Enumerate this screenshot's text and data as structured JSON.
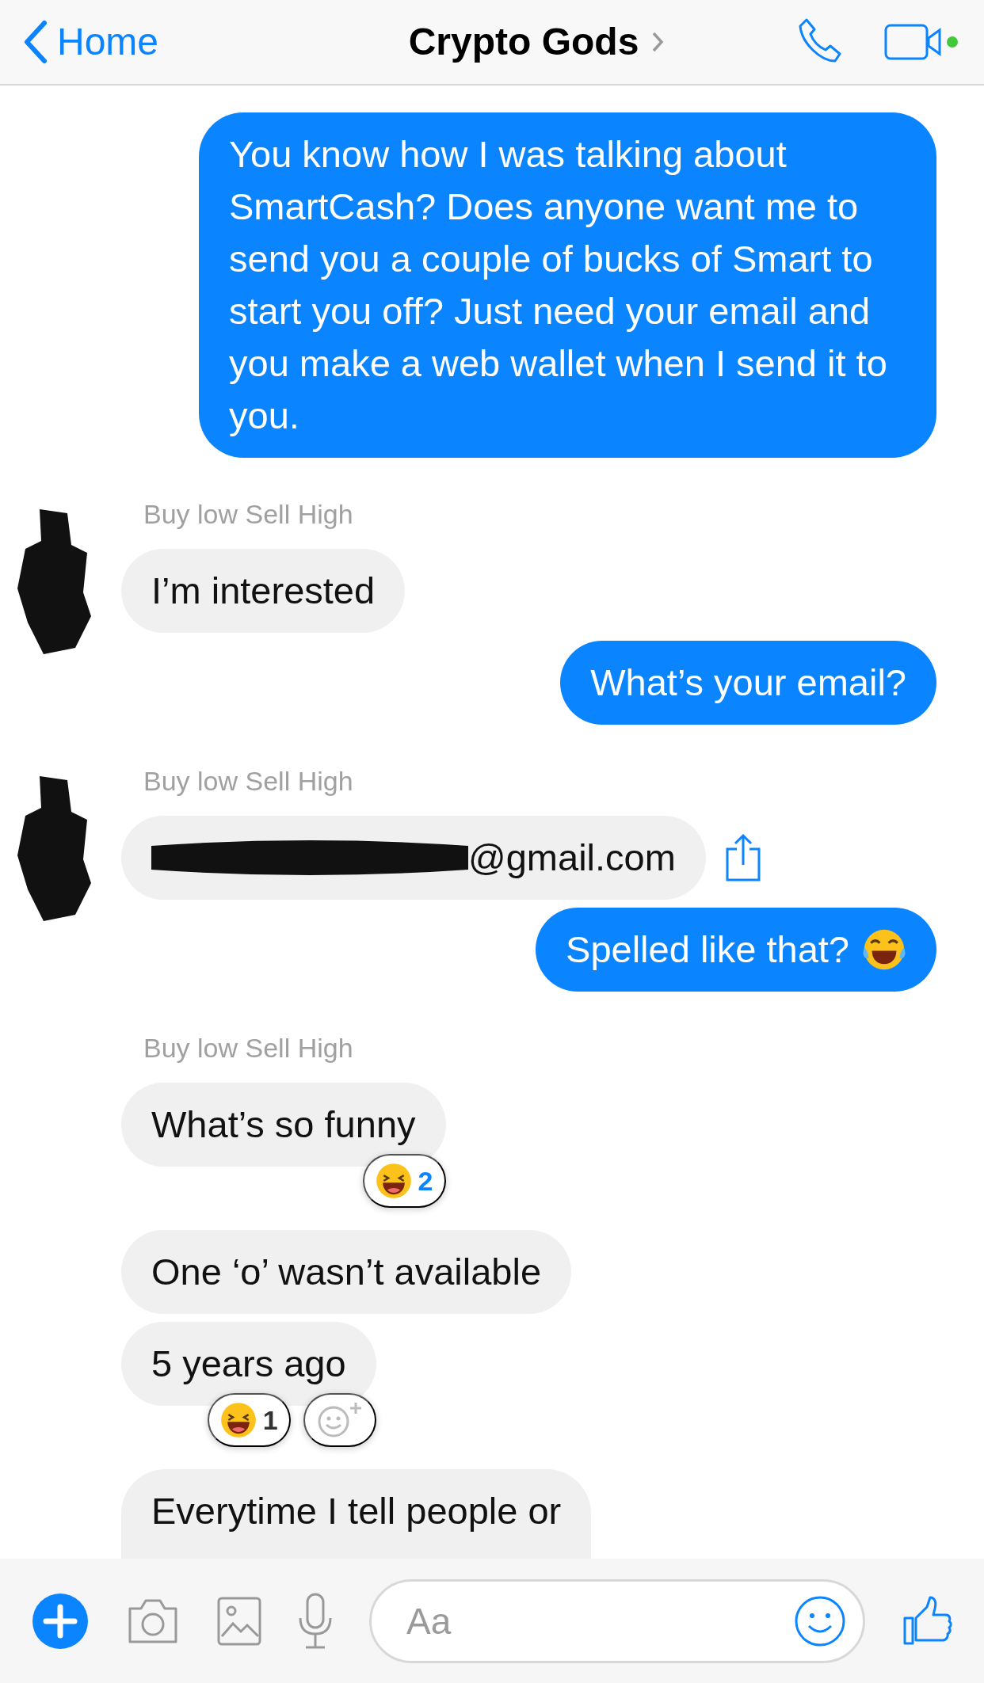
{
  "header": {
    "back_label": "Home",
    "title": "Crypto Gods",
    "online": true
  },
  "messages": [
    {
      "kind": "outgoing",
      "text": "You know how I was talking about SmartCash? Does anyone want me to send you a couple of bucks of Smart to start you off? Just need your email and you make a web wallet when I send it to you."
    },
    {
      "kind": "sender",
      "text": "Buy low Sell High"
    },
    {
      "kind": "incoming",
      "text": "I’m interested",
      "avatar": true
    },
    {
      "kind": "outgoing",
      "text": "What’s your email?"
    },
    {
      "kind": "sender",
      "text": "Buy low Sell High"
    },
    {
      "kind": "incoming",
      "text": "@gmail.com",
      "avatar": true,
      "redacted": true,
      "share": true
    },
    {
      "kind": "outgoing",
      "text": "Spelled like that?",
      "emoji": true
    },
    {
      "kind": "sender",
      "text": "Buy low Sell High"
    },
    {
      "kind": "incoming",
      "text": "What’s so funny",
      "reactions": [
        {
          "count": "2",
          "selected": true
        }
      ]
    },
    {
      "kind": "incoming",
      "text": "One ‘o’ wasn’t available"
    },
    {
      "kind": "incoming",
      "text": "5 years ago",
      "reactions": [
        {
          "count": "1",
          "selected": false
        }
      ],
      "add_reaction": true
    },
    {
      "kind": "incoming",
      "text": "Everytime I tell people or",
      "cut": true
    }
  ],
  "composer": {
    "placeholder": "Aa"
  }
}
